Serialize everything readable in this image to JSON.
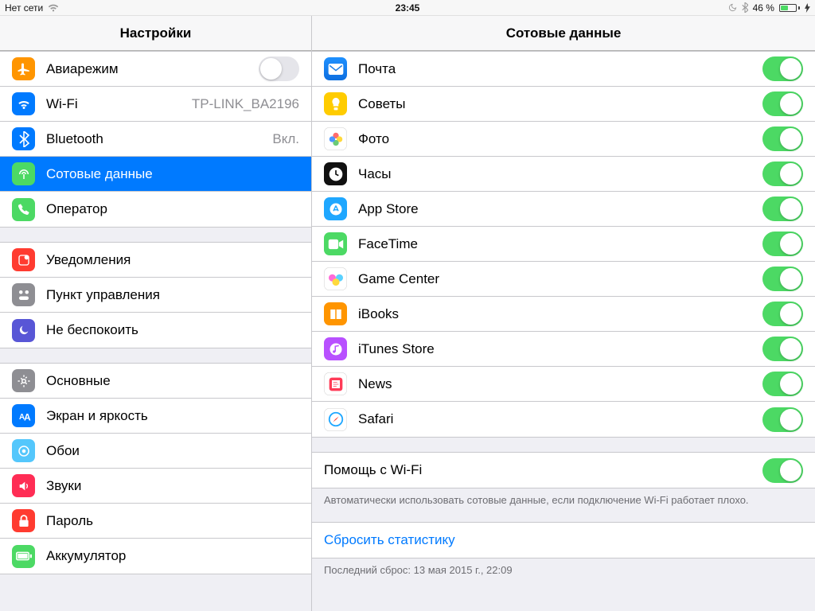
{
  "status": {
    "left_text": "Нет сети",
    "time": "23:45",
    "battery_pct": "46 %",
    "battery_fill": 46
  },
  "sidebar": {
    "title": "Настройки",
    "groups": [
      {
        "items": [
          {
            "key": "airplane",
            "label": "Авиарежим",
            "icon_bg": "#ff9500",
            "icon": "airplane",
            "toggle": false
          },
          {
            "key": "wifi",
            "label": "Wi-Fi",
            "icon_bg": "#007aff",
            "icon": "wifi",
            "value": "TP-LINK_BA2196"
          },
          {
            "key": "bluetooth",
            "label": "Bluetooth",
            "icon_bg": "#007aff",
            "icon": "bluetooth",
            "value": "Вкл."
          },
          {
            "key": "cellular",
            "label": "Сотовые данные",
            "icon_bg": "#4cd964",
            "icon": "cellular",
            "selected": true
          },
          {
            "key": "carrier",
            "label": "Оператор",
            "icon_bg": "#4cd964",
            "icon": "phone"
          }
        ]
      },
      {
        "items": [
          {
            "key": "notifications",
            "label": "Уведомления",
            "icon_bg": "#ff3b30",
            "icon": "notifications"
          },
          {
            "key": "control-center",
            "label": "Пункт управления",
            "icon_bg": "#8e8e93",
            "icon": "control-center"
          },
          {
            "key": "dnd",
            "label": "Не беспокоить",
            "icon_bg": "#5856d6",
            "icon": "moon"
          }
        ]
      },
      {
        "items": [
          {
            "key": "general",
            "label": "Основные",
            "icon_bg": "#8e8e93",
            "icon": "gear"
          },
          {
            "key": "display",
            "label": "Экран и яркость",
            "icon_bg": "#007aff",
            "icon": "display"
          },
          {
            "key": "wallpaper",
            "label": "Обои",
            "icon_bg": "#54c7fc",
            "icon": "wallpaper"
          },
          {
            "key": "sounds",
            "label": "Звуки",
            "icon_bg": "#ff2d55",
            "icon": "sound"
          },
          {
            "key": "passcode",
            "label": "Пароль",
            "icon_bg": "#ff3b30",
            "icon": "lock"
          },
          {
            "key": "battery",
            "label": "Аккумулятор",
            "icon_bg": "#4cd964",
            "icon": "battery"
          }
        ]
      }
    ]
  },
  "detail": {
    "title": "Сотовые данные",
    "apps": [
      {
        "key": "mail",
        "label": "Почта",
        "icon_bg": "linear-gradient(#1e90ff,#0e6fe0)",
        "icon": "mail",
        "on": true
      },
      {
        "key": "tips",
        "label": "Советы",
        "icon_bg": "#ffcc00",
        "icon": "tips",
        "on": true
      },
      {
        "key": "photos",
        "label": "Фото",
        "icon_bg": "#ffffff",
        "icon": "photos",
        "on": true
      },
      {
        "key": "clock",
        "label": "Часы",
        "icon_bg": "#111111",
        "icon": "clock",
        "on": true
      },
      {
        "key": "appstore",
        "label": "App Store",
        "icon_bg": "#1fa7ff",
        "icon": "appstore",
        "on": true
      },
      {
        "key": "facetime",
        "label": "FaceTime",
        "icon_bg": "#4cd964",
        "icon": "facetime",
        "on": true
      },
      {
        "key": "gamecenter",
        "label": "Game Center",
        "icon_bg": "#ffffff",
        "icon": "gamecenter",
        "on": true
      },
      {
        "key": "ibooks",
        "label": "iBooks",
        "icon_bg": "#ff9500",
        "icon": "ibooks",
        "on": true
      },
      {
        "key": "itunes",
        "label": "iTunes Store",
        "icon_bg": "#b850ff",
        "icon": "itunes",
        "on": true
      },
      {
        "key": "news",
        "label": "News",
        "icon_bg": "#ffffff",
        "icon": "news",
        "on": true
      },
      {
        "key": "safari",
        "label": "Safari",
        "icon_bg": "#ffffff",
        "icon": "safari",
        "on": true
      }
    ],
    "wifi_assist": {
      "label": "Помощь с Wi-Fi",
      "on": true,
      "footer": "Автоматически использовать сотовые данные, если подключение Wi-Fi работает плохо."
    },
    "reset": {
      "label": "Сбросить статистику",
      "footer": "Последний сброс: 13 мая 2015 г., 22:09"
    }
  }
}
